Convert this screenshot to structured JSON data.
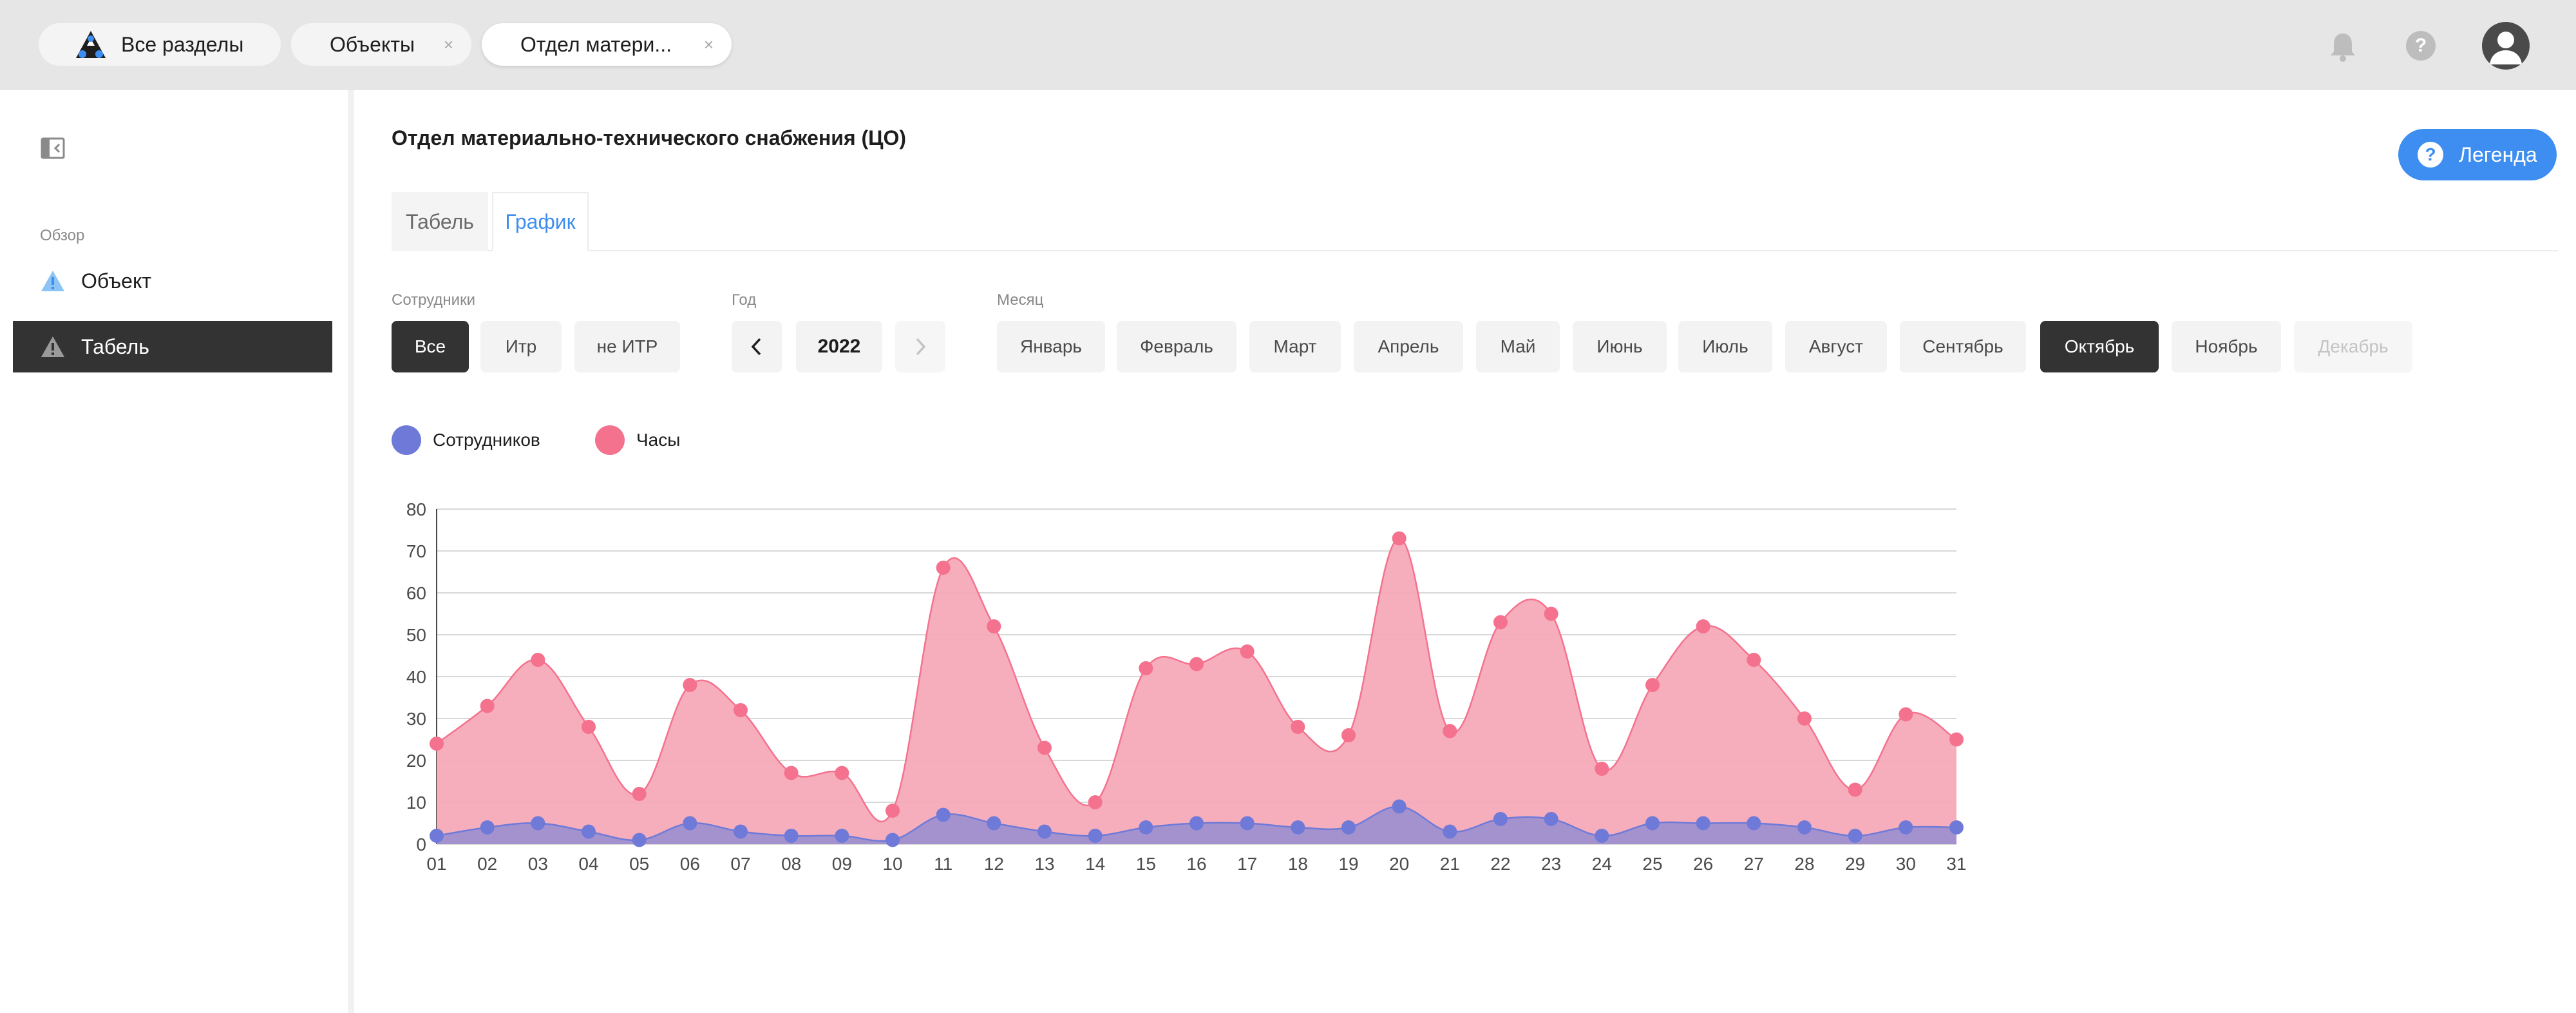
{
  "topbar": {
    "tabs": [
      {
        "label": "Все разделы"
      },
      {
        "label": "Объекты",
        "close": "×"
      },
      {
        "label": "Отдел матери...",
        "close": "×"
      }
    ],
    "help_label": "?"
  },
  "sidebar": {
    "section_label": "Обзор",
    "items": [
      {
        "label": "Объект"
      },
      {
        "label": "Табель"
      }
    ]
  },
  "main": {
    "title": "Отдел материально-технического снабжения (ЦО)",
    "legend_button": {
      "icon": "?",
      "label": "Легенда"
    },
    "tabs": [
      {
        "label": "Табель"
      },
      {
        "label": "График"
      }
    ],
    "filters": {
      "employees_label": "Сотрудники",
      "employees": [
        "Все",
        "Итр",
        "не ИТР"
      ],
      "year_label": "Год",
      "year": "2022",
      "month_label": "Месяц",
      "months": [
        "Январь",
        "Февраль",
        "Март",
        "Апрель",
        "Май",
        "Июнь",
        "Июль",
        "Август",
        "Сентябрь",
        "Октябрь",
        "Ноябрь",
        "Декабрь"
      ]
    }
  },
  "chart_data": {
    "type": "area",
    "x": [
      "01",
      "02",
      "03",
      "04",
      "05",
      "06",
      "07",
      "08",
      "09",
      "10",
      "11",
      "12",
      "13",
      "14",
      "15",
      "16",
      "17",
      "18",
      "19",
      "20",
      "21",
      "22",
      "23",
      "24",
      "25",
      "26",
      "27",
      "28",
      "29",
      "30",
      "31"
    ],
    "ylim": [
      0,
      80
    ],
    "yticks": [
      0,
      10,
      20,
      30,
      40,
      50,
      60,
      70,
      80
    ],
    "grid": true,
    "legend_position": "top-left",
    "series": [
      {
        "name": "Часы",
        "color": "#f4728e",
        "values": [
          24,
          33,
          44,
          28,
          12,
          38,
          32,
          17,
          17,
          8,
          66,
          52,
          23,
          10,
          42,
          43,
          46,
          28,
          26,
          73,
          27,
          53,
          55,
          18,
          38,
          52,
          44,
          30,
          13,
          31,
          25
        ]
      },
      {
        "name": "Сотрудников",
        "color": "#6f7ad8",
        "values": [
          2,
          4,
          5,
          3,
          1,
          5,
          3,
          2,
          2,
          1,
          7,
          5,
          3,
          2,
          4,
          5,
          5,
          4,
          4,
          9,
          3,
          6,
          6,
          2,
          5,
          5,
          5,
          4,
          2,
          4,
          4
        ]
      }
    ]
  }
}
